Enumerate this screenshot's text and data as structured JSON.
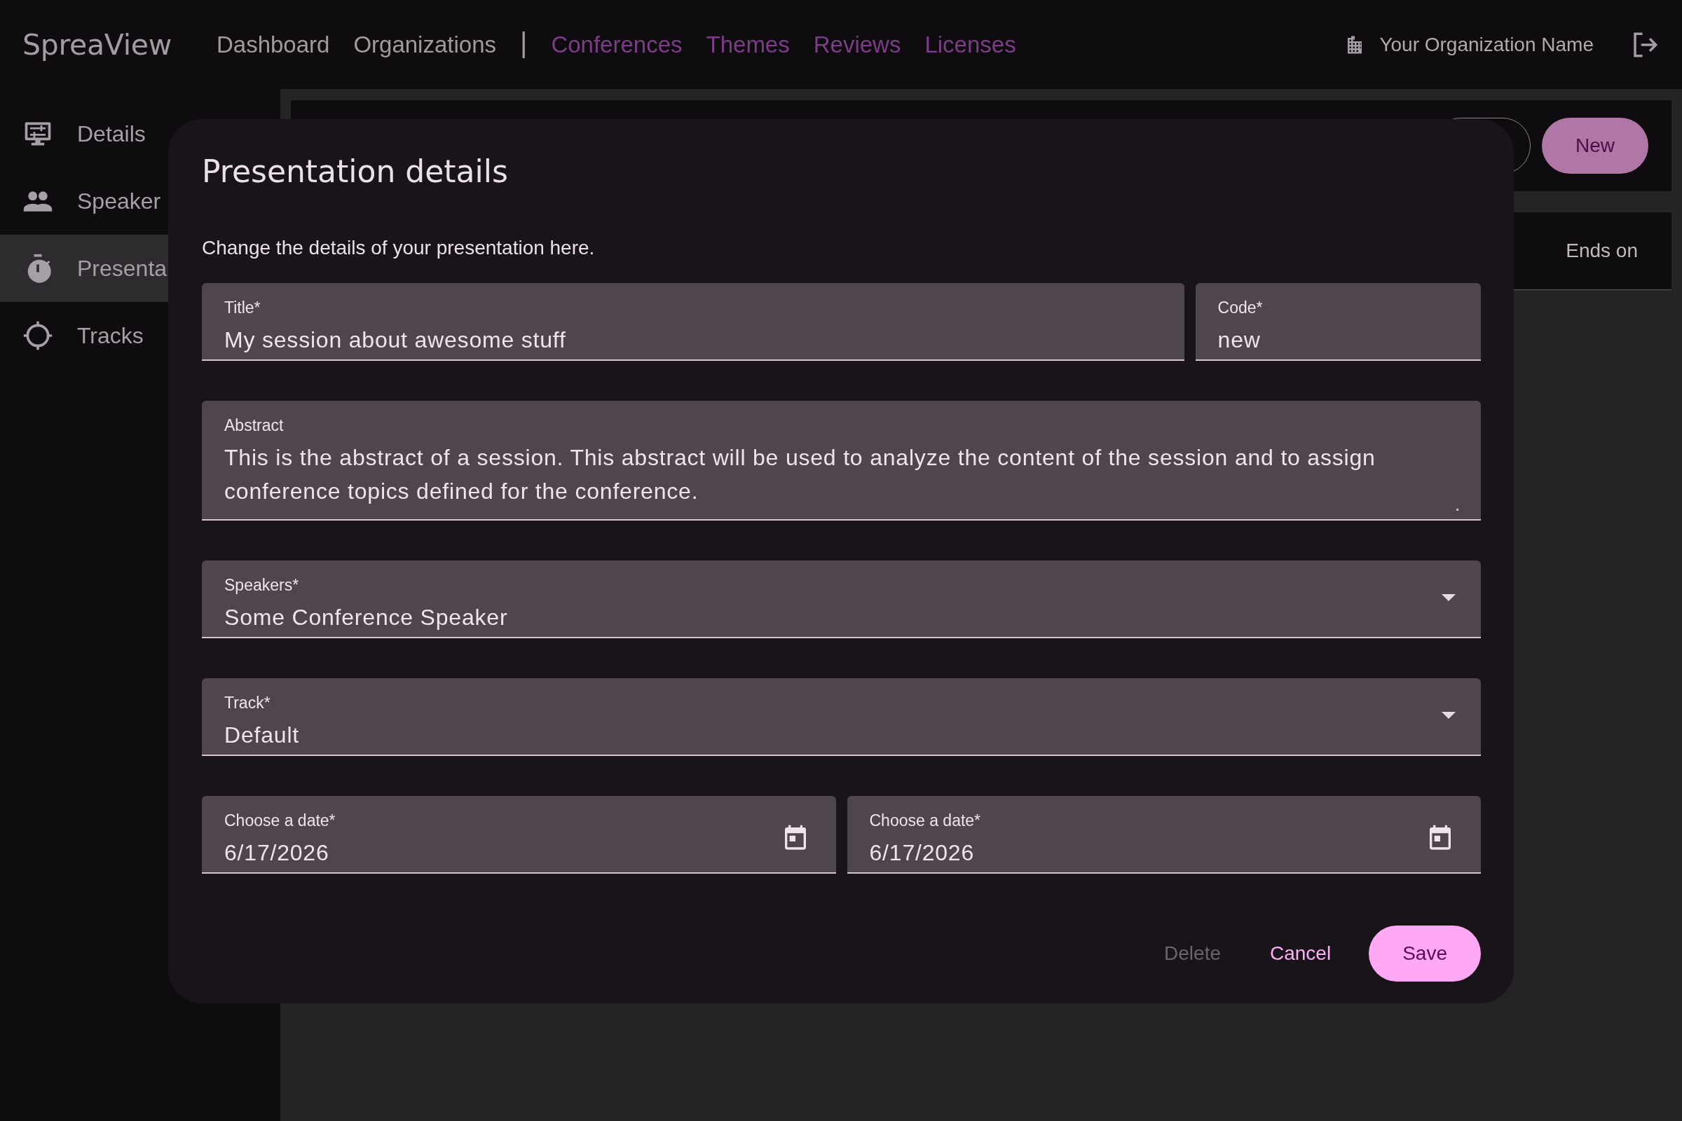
{
  "app": {
    "logo": "SpreaView"
  },
  "nav": {
    "items": [
      {
        "label": "Dashboard",
        "color": "#a09a9f"
      },
      {
        "label": "Organizations",
        "color": "#a09a9f"
      },
      {
        "label": "Conferences",
        "color": "#7b3d86"
      },
      {
        "label": "Themes",
        "color": "#7b3d86"
      },
      {
        "label": "Reviews",
        "color": "#7b3d86"
      },
      {
        "label": "Licenses",
        "color": "#7b3d86"
      }
    ],
    "separator": "|"
  },
  "organization": {
    "name": "Your Organization Name"
  },
  "sidebar": {
    "items": [
      {
        "label": "Details",
        "selected": false
      },
      {
        "label": "Speaker",
        "selected": false
      },
      {
        "label": "Presenta",
        "selected": true
      },
      {
        "label": "Tracks",
        "selected": false
      }
    ]
  },
  "background": {
    "new_button": "New",
    "column_header": "Ends on"
  },
  "dialog": {
    "title": "Presentation details",
    "description": "Change the details of your presentation here.",
    "rows": [
      [
        {
          "kind": "text",
          "label": "Title*",
          "value": "My session about awesome stuff"
        },
        {
          "kind": "text",
          "label": "Code*",
          "value": "new"
        }
      ],
      [
        {
          "kind": "textarea",
          "label": "Abstract",
          "value": "This is the abstract of a session. This abstract will be used to analyze the content of the session and to assign conference topics defined for the conference."
        }
      ],
      [
        {
          "kind": "select",
          "label": "Speakers*",
          "value": "Some Conference Speaker"
        }
      ],
      [
        {
          "kind": "select",
          "label": "Track*",
          "value": "Default"
        }
      ],
      [
        {
          "kind": "date",
          "label": "Choose a date*",
          "value": "6/17/2026"
        },
        {
          "kind": "date",
          "label": "Choose a date*",
          "value": "6/17/2026"
        }
      ]
    ],
    "actions": [
      {
        "label": "Delete",
        "kind": "text",
        "disabled": true
      },
      {
        "label": "Cancel",
        "kind": "text",
        "disabled": false
      },
      {
        "label": "Save",
        "kind": "filled",
        "disabled": false
      }
    ]
  }
}
